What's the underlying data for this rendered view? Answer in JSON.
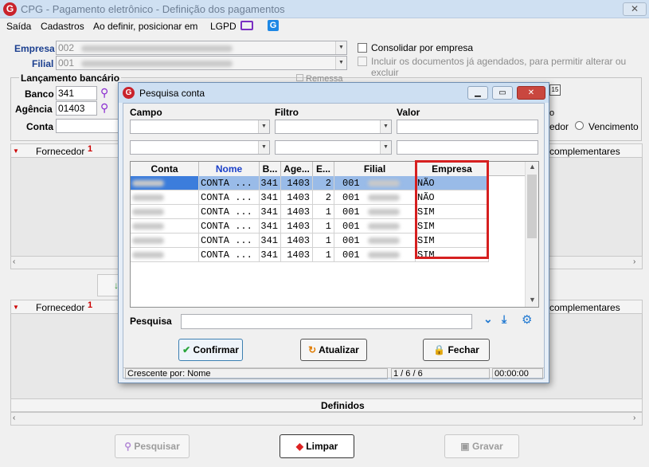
{
  "main": {
    "title": "CPG - Pagamento eletrônico - Definição dos pagamentos",
    "menu": [
      "Saída",
      "Cadastros",
      "Ao definir, posicionar em",
      "LGPD"
    ],
    "empresa_label": "Empresa",
    "empresa_value": "002",
    "filial_label": "Filial",
    "filial_value": "001",
    "consolidar_label": "Consolidar por empresa",
    "incluir_label": "Incluir os documentos já agendados, para permitir alterar ou excluir",
    "lancamento_label": "Lançamento bancário",
    "remessa_label": "Remessa",
    "banco_label": "Banco",
    "banco_value": "341",
    "agencia_label": "Agência",
    "agencia_value": "01403",
    "conta_label": "Conta",
    "radio_fornecedor": "edor",
    "radio_vencimento": "Vencimento",
    "fornecedor_col": "Fornecedor",
    "fornecedor_sort": "1",
    "complementares_col": "complementares",
    "definidos_label": "Definidos",
    "btn_pesquisar": "Pesquisar",
    "btn_limpar": "Limpar",
    "btn_gravar": "Gravar"
  },
  "dialog": {
    "title": "Pesquisa conta",
    "campo_label": "Campo",
    "filtro_label": "Filtro",
    "valor_label": "Valor",
    "columns": [
      "Conta",
      "Nome",
      "B...",
      "Age...",
      "E...",
      "Filial",
      "Empresa Comp."
    ],
    "rows": [
      {
        "nome": "CONTA ...",
        "banco": "341",
        "agencia": "1403",
        "e": "2",
        "filial": "001",
        "empresa_comp": "NÃO"
      },
      {
        "nome": "CONTA ...",
        "banco": "341",
        "agencia": "1403",
        "e": "2",
        "filial": "001",
        "empresa_comp": "NÃO"
      },
      {
        "nome": "CONTA ...",
        "banco": "341",
        "agencia": "1403",
        "e": "1",
        "filial": "001",
        "empresa_comp": "SIM"
      },
      {
        "nome": "CONTA ...",
        "banco": "341",
        "agencia": "1403",
        "e": "1",
        "filial": "001",
        "empresa_comp": "SIM"
      },
      {
        "nome": "CONTA ...",
        "banco": "341",
        "agencia": "1403",
        "e": "1",
        "filial": "001",
        "empresa_comp": "SIM"
      },
      {
        "nome": "CONTA ...",
        "banco": "341",
        "agencia": "1403",
        "e": "1",
        "filial": "001",
        "empresa_comp": "SIM"
      }
    ],
    "pesquisa_label": "Pesquisa",
    "btn_confirmar": "Confirmar",
    "btn_atualizar": "Atualizar",
    "btn_fechar": "Fechar",
    "status_sort": "Crescente por: Nome",
    "status_count": "1 / 6 / 6",
    "status_time": "00:00:00"
  },
  "colors": {
    "highlight_box": "#d62020",
    "selected_row": "#99bbe8",
    "label_blue": "#1b3f8f"
  }
}
